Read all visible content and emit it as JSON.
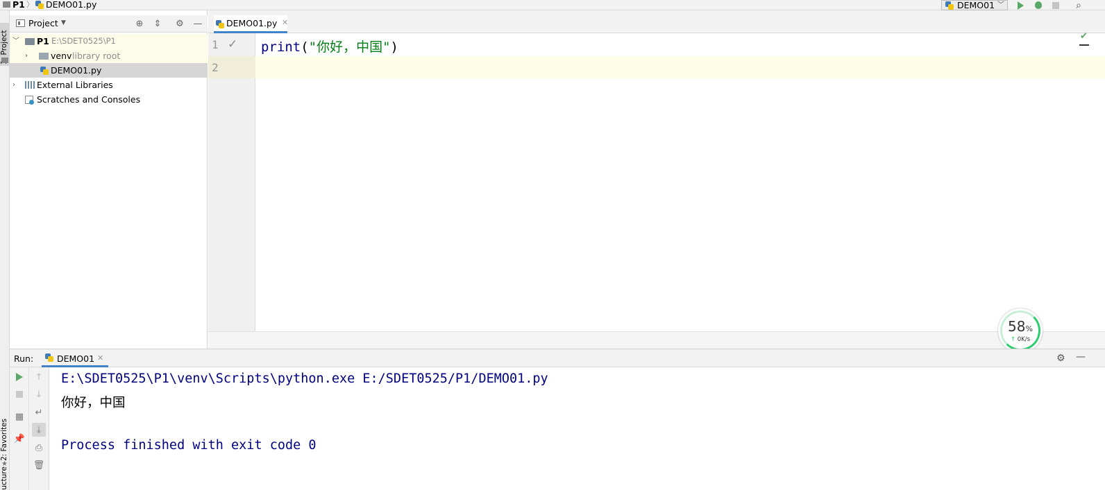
{
  "navbar": {
    "project": "P1",
    "separator": "〉",
    "file": "DEMO01.py"
  },
  "toolbar": {
    "run_config": "DEMO01"
  },
  "stripe": {
    "project_tab": "1: Project",
    "favorites_tab": "2: Favorites",
    "structure_tab": "Structure"
  },
  "project_panel": {
    "title": "Project",
    "tree": {
      "root_name": "P1",
      "root_path": "E:\\SDET0525\\P1",
      "venv_name": "venv",
      "venv_note": "library root",
      "file_name": "DEMO01.py",
      "ext_libs": "External Libraries",
      "scratches": "Scratches and Consoles"
    }
  },
  "editor": {
    "tab_label": "DEMO01.py",
    "line_numbers": [
      "1",
      "2"
    ],
    "code": {
      "fn": "print",
      "open": "(",
      "string": "\"你好，中国\"",
      "close": ")"
    }
  },
  "net_widget": {
    "percent": "58",
    "percent_unit": "%",
    "speed": "0K/s",
    "arrow": "↑"
  },
  "run_panel": {
    "label": "Run:",
    "tab_label": "DEMO01",
    "console": {
      "command": "E:\\SDET0525\\P1\\venv\\Scripts\\python.exe E:/SDET0525/P1/DEMO01.py",
      "output": "你好，中国",
      "exit": "Process finished with exit code 0"
    }
  },
  "colors": {
    "accent_tab": "#4083c9",
    "run_green": "#59a869",
    "keyword_blue": "#000080",
    "string_green": "#067d17"
  }
}
